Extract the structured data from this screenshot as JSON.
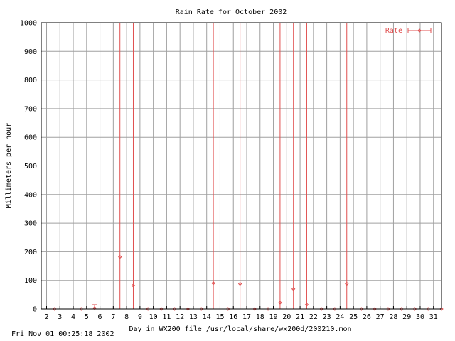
{
  "chart_data": {
    "type": "scatter",
    "title": "Rain Rate for October 2002",
    "xlabel": "Day in WX200 file /usr/local/share/wx200d/200210.mon",
    "ylabel": "Millimeters per hour",
    "xlim": [
      1.6,
      31.6
    ],
    "ylim": [
      0,
      1000
    ],
    "xticks": [
      2,
      3,
      4,
      5,
      6,
      7,
      8,
      9,
      10,
      11,
      12,
      13,
      14,
      15,
      16,
      17,
      18,
      19,
      20,
      21,
      22,
      23,
      24,
      25,
      26,
      27,
      28,
      29,
      30,
      31
    ],
    "yticks": [
      0,
      100,
      200,
      300,
      400,
      500,
      600,
      700,
      800,
      900,
      1000
    ],
    "grid": true,
    "legend_position": "top-right",
    "series": [
      {
        "name": "Rate",
        "color": "#e05050",
        "style": "points-with-error-bars",
        "points": [
          {
            "x": 2.6,
            "y": 0,
            "lo": 0,
            "hi": 0
          },
          {
            "x": 4.6,
            "y": 0,
            "lo": 0,
            "hi": 0
          },
          {
            "x": 5.6,
            "y": 3,
            "lo": 0,
            "hi": 15
          },
          {
            "x": 7.5,
            "y": 182,
            "lo": 0,
            "hi": 1000
          },
          {
            "x": 8.5,
            "y": 82,
            "lo": 0,
            "hi": 1000
          },
          {
            "x": 9.6,
            "y": 0,
            "lo": 0,
            "hi": 0
          },
          {
            "x": 10.6,
            "y": 0,
            "lo": 0,
            "hi": 0
          },
          {
            "x": 11.6,
            "y": 0,
            "lo": 0,
            "hi": 0
          },
          {
            "x": 12.6,
            "y": 0,
            "lo": 0,
            "hi": 0
          },
          {
            "x": 13.6,
            "y": 0,
            "lo": 0,
            "hi": 0
          },
          {
            "x": 14.5,
            "y": 90,
            "lo": 0,
            "hi": 1000
          },
          {
            "x": 15.6,
            "y": 0,
            "lo": 0,
            "hi": 0
          },
          {
            "x": 16.5,
            "y": 88,
            "lo": 0,
            "hi": 1000
          },
          {
            "x": 17.6,
            "y": 0,
            "lo": 0,
            "hi": 0
          },
          {
            "x": 18.6,
            "y": 0,
            "lo": 0,
            "hi": 0
          },
          {
            "x": 19.5,
            "y": 22,
            "lo": 0,
            "hi": 1000
          },
          {
            "x": 20.5,
            "y": 70,
            "lo": 0,
            "hi": 1000
          },
          {
            "x": 21.5,
            "y": 15,
            "lo": 0,
            "hi": 1000
          },
          {
            "x": 22.6,
            "y": 0,
            "lo": 0,
            "hi": 0
          },
          {
            "x": 23.6,
            "y": 0,
            "lo": 0,
            "hi": 0
          },
          {
            "x": 24.5,
            "y": 88,
            "lo": 0,
            "hi": 1000
          },
          {
            "x": 25.6,
            "y": 0,
            "lo": 0,
            "hi": 0
          },
          {
            "x": 26.6,
            "y": 0,
            "lo": 0,
            "hi": 0
          },
          {
            "x": 27.6,
            "y": 0,
            "lo": 0,
            "hi": 0
          },
          {
            "x": 28.6,
            "y": 0,
            "lo": 0,
            "hi": 0
          },
          {
            "x": 29.6,
            "y": 0,
            "lo": 0,
            "hi": 0
          },
          {
            "x": 30.6,
            "y": 0,
            "lo": 0,
            "hi": 0
          },
          {
            "x": 31.6,
            "y": 0,
            "lo": 0,
            "hi": 0
          }
        ]
      }
    ]
  },
  "footer": {
    "timestamp": "Fri Nov 01 00:25:18 2002"
  }
}
